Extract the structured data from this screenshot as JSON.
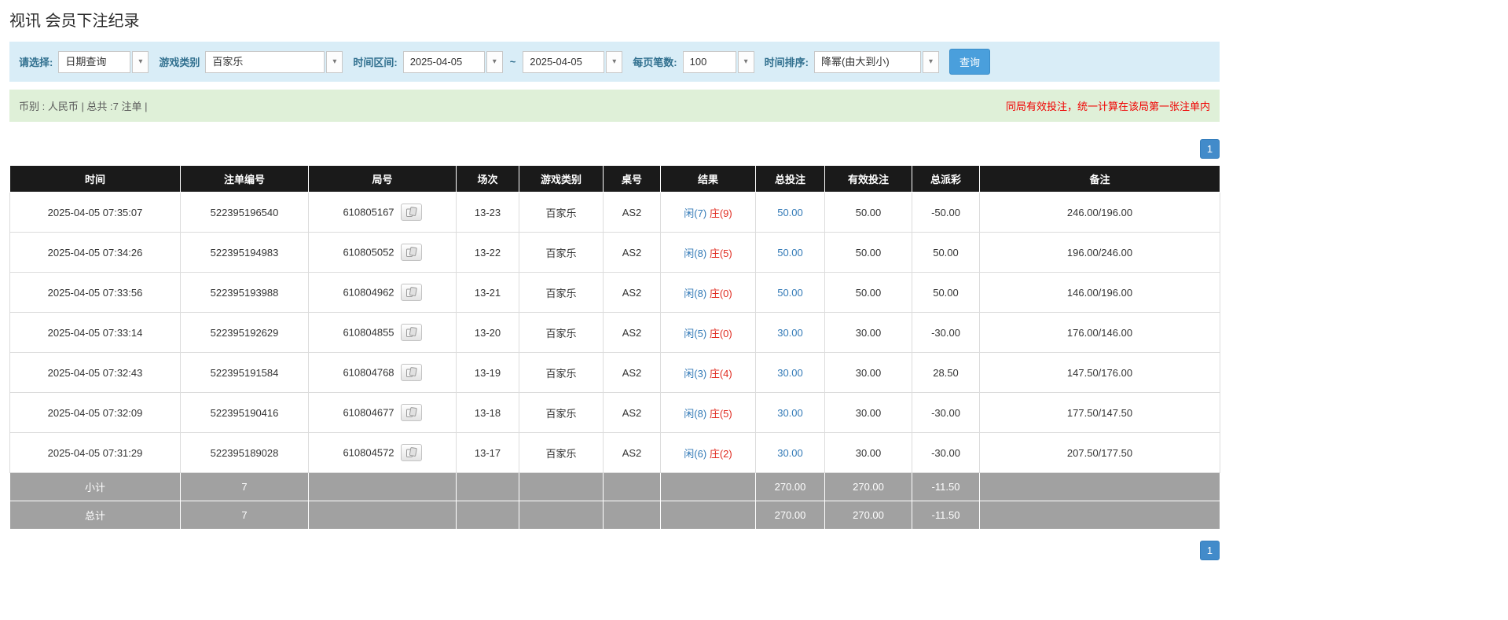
{
  "page": {
    "title": "视讯 会员下注纪录"
  },
  "icons": {
    "chevron_down": "▾"
  },
  "filters": {
    "select_label": "请选择:",
    "select_value": "日期查询",
    "game_type_label": "游戏类别",
    "game_type_value": "百家乐",
    "time_range_label": "时间区间:",
    "date_from": "2025-04-05",
    "date_separator": "~",
    "date_to": "2025-04-05",
    "per_page_label": "每页笔数:",
    "per_page_value": "100",
    "sort_label": "时间排序:",
    "sort_value": "降幂(由大到小)",
    "search_button": "查询"
  },
  "info_bar": {
    "left": "币别 : 人民币 | 总共 :7 注单 |",
    "right": "同局有效投注，统一计算在该局第一张注单内"
  },
  "pagination": {
    "page": "1"
  },
  "table": {
    "headers": [
      "时间",
      "注单编号",
      "局号",
      "场次",
      "游戏类别",
      "桌号",
      "结果",
      "总投注",
      "有效投注",
      "总派彩",
      "备注"
    ],
    "rows": [
      {
        "time": "2025-04-05 07:35:07",
        "bet_id": "522395196540",
        "round_id": "610805167",
        "session": "13-23",
        "game_type": "百家乐",
        "table_no": "AS2",
        "result_player": "闲(7)",
        "result_banker": "庄(9)",
        "total_bet": "50.00",
        "valid_bet": "50.00",
        "payout": "-50.00",
        "remark": "246.00/196.00"
      },
      {
        "time": "2025-04-05 07:34:26",
        "bet_id": "522395194983",
        "round_id": "610805052",
        "session": "13-22",
        "game_type": "百家乐",
        "table_no": "AS2",
        "result_player": "闲(8)",
        "result_banker": "庄(5)",
        "total_bet": "50.00",
        "valid_bet": "50.00",
        "payout": "50.00",
        "remark": "196.00/246.00"
      },
      {
        "time": "2025-04-05 07:33:56",
        "bet_id": "522395193988",
        "round_id": "610804962",
        "session": "13-21",
        "game_type": "百家乐",
        "table_no": "AS2",
        "result_player": "闲(8)",
        "result_banker": "庄(0)",
        "total_bet": "50.00",
        "valid_bet": "50.00",
        "payout": "50.00",
        "remark": "146.00/196.00"
      },
      {
        "time": "2025-04-05 07:33:14",
        "bet_id": "522395192629",
        "round_id": "610804855",
        "session": "13-20",
        "game_type": "百家乐",
        "table_no": "AS2",
        "result_player": "闲(5)",
        "result_banker": "庄(0)",
        "total_bet": "30.00",
        "valid_bet": "30.00",
        "payout": "-30.00",
        "remark": "176.00/146.00"
      },
      {
        "time": "2025-04-05 07:32:43",
        "bet_id": "522395191584",
        "round_id": "610804768",
        "session": "13-19",
        "game_type": "百家乐",
        "table_no": "AS2",
        "result_player": "闲(3)",
        "result_banker": "庄(4)",
        "total_bet": "30.00",
        "valid_bet": "30.00",
        "payout": "28.50",
        "remark": "147.50/176.00"
      },
      {
        "time": "2025-04-05 07:32:09",
        "bet_id": "522395190416",
        "round_id": "610804677",
        "session": "13-18",
        "game_type": "百家乐",
        "table_no": "AS2",
        "result_player": "闲(8)",
        "result_banker": "庄(5)",
        "total_bet": "30.00",
        "valid_bet": "30.00",
        "payout": "-30.00",
        "remark": "177.50/147.50"
      },
      {
        "time": "2025-04-05 07:31:29",
        "bet_id": "522395189028",
        "round_id": "610804572",
        "session": "13-17",
        "game_type": "百家乐",
        "table_no": "AS2",
        "result_player": "闲(6)",
        "result_banker": "庄(2)",
        "total_bet": "30.00",
        "valid_bet": "30.00",
        "payout": "-30.00",
        "remark": "207.50/177.50"
      }
    ],
    "subtotal": {
      "label": "小计",
      "count": "7",
      "total_bet": "270.00",
      "valid_bet": "270.00",
      "payout": "-11.50"
    },
    "total": {
      "label": "总计",
      "count": "7",
      "total_bet": "270.00",
      "valid_bet": "270.00",
      "payout": "-11.50"
    }
  }
}
